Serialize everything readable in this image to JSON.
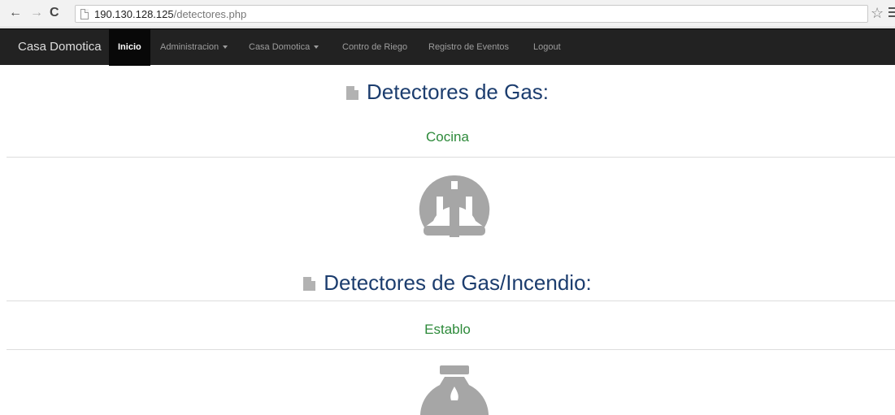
{
  "browser": {
    "url_host": "190.130.128.125",
    "url_path": "/detectores.php"
  },
  "navbar": {
    "brand": "Casa Domotica",
    "items": [
      {
        "label": "Inicio",
        "active": true
      },
      {
        "label": "Administracion",
        "dropdown": true
      },
      {
        "label": "Casa Domotica",
        "dropdown": true
      },
      {
        "label": "Contro de Riego"
      },
      {
        "label": "Registro de Eventos"
      },
      {
        "label": "Logout"
      }
    ]
  },
  "sections": [
    {
      "title": "Detectores de Gas:",
      "location": "Cocina",
      "icon": "gas-gauge-icon"
    },
    {
      "title": "Detectores de Gas/Incendio:",
      "location": "Establo",
      "icon": "fire-gauge-icon"
    }
  ],
  "colors": {
    "navbar": "#222222",
    "heading": "#1c3d6e",
    "location": "#2d8a3a",
    "icon": "#a6a6a6"
  }
}
